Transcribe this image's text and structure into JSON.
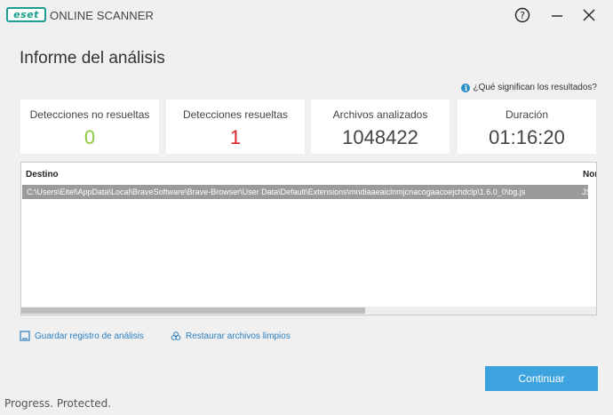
{
  "app": {
    "logo_text": "eset",
    "name": "ONLINE SCANNER"
  },
  "window": {
    "help_icon": "help-icon",
    "minimize_icon": "minimize-icon",
    "close_icon": "close-icon"
  },
  "page": {
    "title": "Informe del análisis",
    "help_link": "¿Qué significan los resultados?"
  },
  "stats": [
    {
      "label": "Detecciones no resueltas",
      "value": "0",
      "color": "#8cc63f"
    },
    {
      "label": "Detecciones resueltas",
      "value": "1",
      "color": "#d9262b"
    },
    {
      "label": "Archivos analizados",
      "value": "1048422",
      "color": "#444444"
    },
    {
      "label": "Duración",
      "value": "01:16:20",
      "color": "#444444"
    }
  ],
  "table": {
    "columns": [
      "Destino",
      "Nombre"
    ],
    "rows": [
      {
        "path": "C:\\Users\\Eitel\\AppData\\Local\\BraveSoftware\\Brave-Browser\\User Data\\Default\\Extensions\\mndiaaeaiclnmjcnacogaacoejchdclp\\1.6.0_0\\bg.js",
        "name": "JS"
      }
    ],
    "scroll_position": 0.0
  },
  "actions": {
    "save_log": "Guardar registro de análisis",
    "restore": "Restaurar archivos limpios",
    "continue": "Continuar"
  },
  "footer": "Progress. Protected.",
  "colors": {
    "accent": "#3ca3df",
    "link": "#2b7fc0",
    "logo": "#1a9e8f"
  }
}
